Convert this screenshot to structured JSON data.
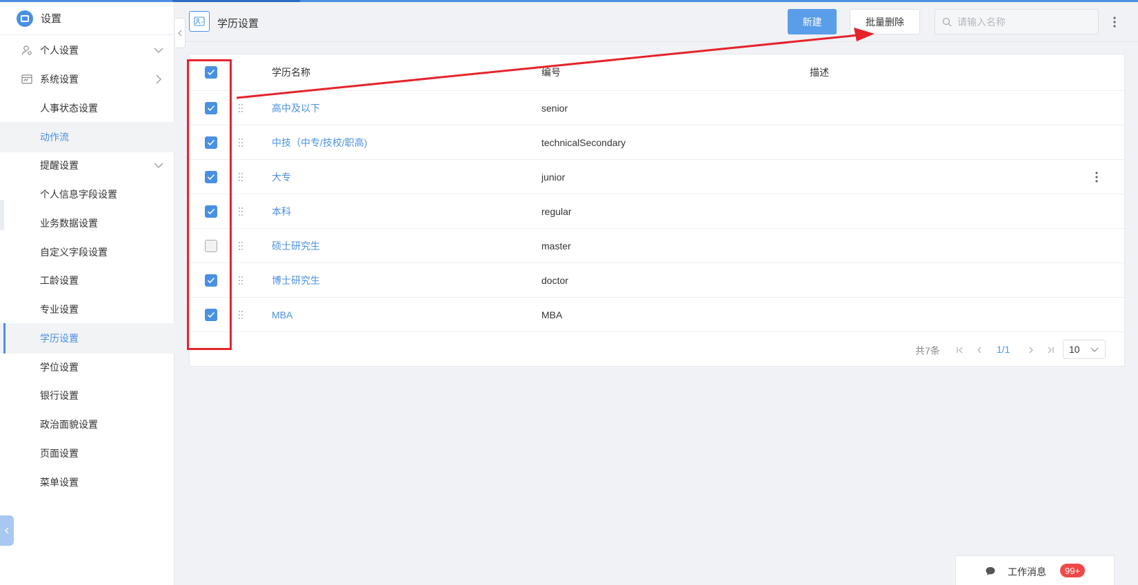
{
  "sidebar": {
    "title": "设置",
    "items": [
      {
        "label": "个人设置",
        "level": "parent",
        "icon": "user-settings-icon",
        "chevron": "down"
      },
      {
        "label": "系统设置",
        "level": "parent",
        "icon": "system-settings-icon",
        "chevron": "right"
      },
      {
        "label": "人事状态设置",
        "level": "child"
      },
      {
        "label": "动作流",
        "level": "child",
        "state": "hover"
      },
      {
        "label": "提醒设置",
        "level": "child",
        "chevron": "down"
      },
      {
        "label": "个人信息字段设置",
        "level": "child"
      },
      {
        "label": "业务数据设置",
        "level": "child"
      },
      {
        "label": "自定义字段设置",
        "level": "child"
      },
      {
        "label": "工龄设置",
        "level": "child"
      },
      {
        "label": "专业设置",
        "level": "child"
      },
      {
        "label": "学历设置",
        "level": "child",
        "state": "active"
      },
      {
        "label": "学位设置",
        "level": "child"
      },
      {
        "label": "银行设置",
        "level": "child"
      },
      {
        "label": "政治面貌设置",
        "level": "child"
      },
      {
        "label": "页面设置",
        "level": "child"
      },
      {
        "label": "菜单设置",
        "level": "child"
      }
    ]
  },
  "header": {
    "title": "学历设置",
    "new_label": "新建",
    "bulk_delete_label": "批量删除",
    "search_placeholder": "请输入名称"
  },
  "table": {
    "columns": [
      "学历名称",
      "编号",
      "描述"
    ],
    "header_checked": true,
    "rows": [
      {
        "name": "高中及以下",
        "code": "senior",
        "desc": "",
        "checked": true
      },
      {
        "name": "中技（中专/技校/职高)",
        "code": "technicalSecondary",
        "desc": "",
        "checked": true
      },
      {
        "name": "大专",
        "code": "junior",
        "desc": "",
        "checked": true
      },
      {
        "name": "本科",
        "code": "regular",
        "desc": "",
        "checked": true
      },
      {
        "name": "硕士研究生",
        "code": "master",
        "desc": "",
        "checked": false
      },
      {
        "name": "博士研究生",
        "code": "doctor",
        "desc": "",
        "checked": true
      },
      {
        "name": "MBA",
        "code": "MBA",
        "desc": "",
        "checked": true
      }
    ]
  },
  "pagination": {
    "total": "共7条",
    "page": "1/1",
    "page_size": "10"
  },
  "messages": {
    "label": "工作消息",
    "badge": "99+"
  },
  "colors": {
    "accent": "#4a90e2",
    "annotation": "#e5232b",
    "badge": "#f04848"
  }
}
